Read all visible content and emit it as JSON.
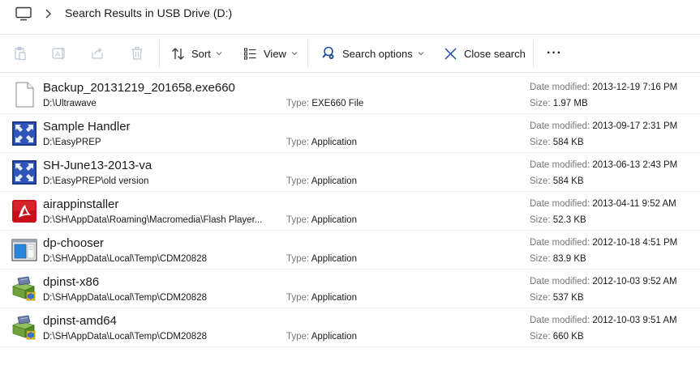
{
  "address": {
    "location_text": "Search Results in USB Drive (D:)"
  },
  "toolbar": {
    "sort_label": "Sort",
    "view_label": "View",
    "search_options_label": "Search options",
    "close_search_label": "Close search",
    "more_label": "···"
  },
  "labels": {
    "date_modified": "Date modified:",
    "type": "Type:",
    "size": "Size:"
  },
  "files": [
    {
      "name": "Backup_20131219_201658.exe660",
      "path": "D:\\Ultrawave",
      "type": "EXE660 File",
      "date": "2013-12-19 7:16 PM",
      "size": "1.97 MB",
      "icon": "blank-file-icon"
    },
    {
      "name": "Sample Handler",
      "path": "D:\\EasyPREP",
      "type": "Application",
      "date": "2013-09-17 2:31 PM",
      "size": "584 KB",
      "icon": "blue-arrows-app-icon"
    },
    {
      "name": "SH-June13-2013-va",
      "path": "D:\\EasyPREP\\old version",
      "type": "Application",
      "date": "2013-06-13 2:43 PM",
      "size": "584 KB",
      "icon": "blue-arrows-app-icon"
    },
    {
      "name": "airappinstaller",
      "path": "D:\\SH\\AppData\\Roaming\\Macromedia\\Flash Player...",
      "type": "Application",
      "date": "2013-04-11 9:52 AM",
      "size": "52.3 KB",
      "icon": "adobe-air-icon"
    },
    {
      "name": "dp-chooser",
      "path": "D:\\SH\\AppData\\Local\\Temp\\CDM20828",
      "type": "Application",
      "date": "2012-10-18 4:51 PM",
      "size": "83.9 KB",
      "icon": "window-app-icon"
    },
    {
      "name": "dpinst-x86",
      "path": "D:\\SH\\AppData\\Local\\Temp\\CDM20828",
      "type": "Application",
      "date": "2012-10-03 9:52 AM",
      "size": "537 KB",
      "icon": "installer-box-icon"
    },
    {
      "name": "dpinst-amd64",
      "path": "D:\\SH\\AppData\\Local\\Temp\\CDM20828",
      "type": "Application",
      "date": "2012-10-03 9:51 AM",
      "size": "660 KB",
      "icon": "installer-box-icon"
    }
  ]
}
